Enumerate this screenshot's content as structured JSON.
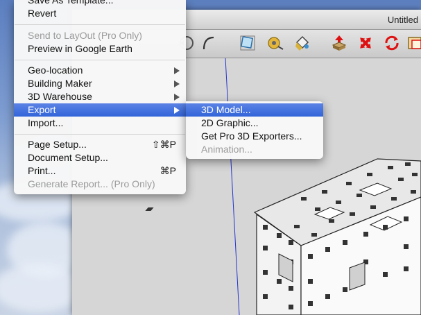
{
  "window": {
    "title": "Untitled"
  },
  "toolbar": {
    "tools": [
      {
        "icon": "orbit-icon"
      },
      {
        "icon": "arc-icon"
      },
      {
        "icon": "scale-icon"
      },
      {
        "icon": "tape-measure-icon"
      },
      {
        "icon": "paint-bucket-icon"
      },
      {
        "icon": "push-pull-icon"
      },
      {
        "icon": "move-icon"
      },
      {
        "icon": "rotate-icon"
      },
      {
        "icon": "offset-icon"
      }
    ]
  },
  "file_menu": {
    "items": [
      {
        "label": "Save As Template...",
        "enabled": true
      },
      {
        "label": "Revert",
        "enabled": true
      },
      {
        "label": "Send to LayOut (Pro Only)",
        "enabled": false
      },
      {
        "label": "Preview in Google Earth",
        "enabled": true
      },
      {
        "label": "Geo-location",
        "enabled": true,
        "submenu": true
      },
      {
        "label": "Building Maker",
        "enabled": true,
        "submenu": true
      },
      {
        "label": "3D Warehouse",
        "enabled": true,
        "submenu": true
      },
      {
        "label": "Export",
        "enabled": true,
        "submenu": true,
        "highlighted": true
      },
      {
        "label": "Import...",
        "enabled": true
      },
      {
        "label": "Page Setup...",
        "enabled": true,
        "shortcut": "⇧⌘P"
      },
      {
        "label": "Document Setup...",
        "enabled": true
      },
      {
        "label": "Print...",
        "enabled": true,
        "shortcut": "⌘P"
      },
      {
        "label": "Generate Report... (Pro Only)",
        "enabled": false
      }
    ]
  },
  "export_submenu": {
    "items": [
      {
        "label": "3D Model...",
        "enabled": true,
        "highlighted": true
      },
      {
        "label": "2D Graphic...",
        "enabled": true
      },
      {
        "label": "Get Pro 3D Exporters...",
        "enabled": true
      },
      {
        "label": "Animation...",
        "enabled": false
      }
    ]
  },
  "colors": {
    "menu_highlight": "#3d6de0",
    "axis_blue": "#2233cc",
    "viewport": "#d6d6d6"
  }
}
